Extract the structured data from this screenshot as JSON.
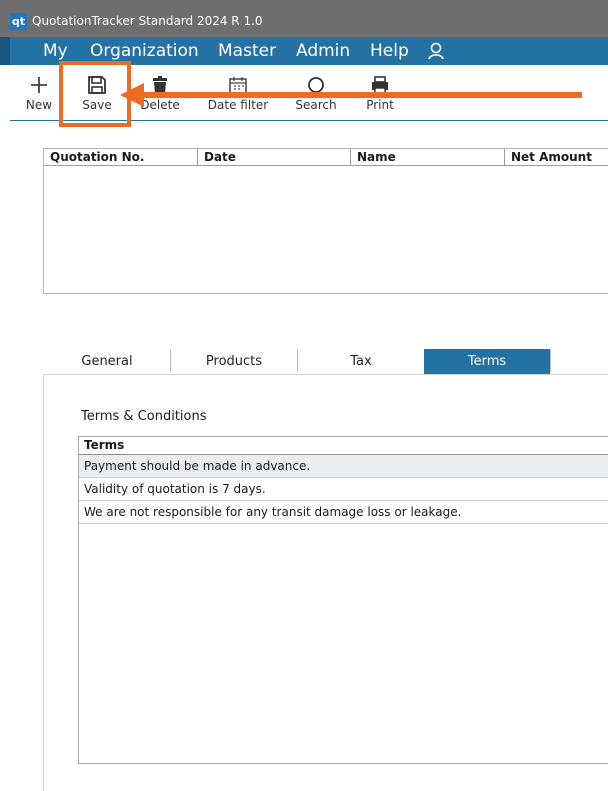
{
  "window": {
    "logo": "qt",
    "title": "QuotationTracker Standard 2024 R 1.0"
  },
  "menu": {
    "items": [
      "My",
      "Organization",
      "Master",
      "Admin",
      "Help"
    ],
    "user_icon": "user-icon"
  },
  "toolbar": {
    "new_label": "New",
    "save_label": "Save",
    "delete_label": "Delete",
    "date_filter_label": "Date filter",
    "search_label": "Search",
    "print_label": "Print"
  },
  "grid": {
    "columns": [
      "Quotation No.",
      "Date",
      "Name",
      "Net Amount"
    ],
    "rows": []
  },
  "tabs": {
    "items": [
      "General",
      "Products",
      "Tax",
      "Terms"
    ],
    "active": "Terms"
  },
  "terms": {
    "caption": "Terms & Conditions",
    "header": "Terms",
    "rows": [
      "Payment should be made in advance.",
      "Validity of quotation is 7 days.",
      "We are not responsible for any transit damage loss or leakage."
    ]
  },
  "colors": {
    "accent": "#2471a3",
    "annotation": "#f06a22",
    "titlebar": "#6e6e6e"
  }
}
